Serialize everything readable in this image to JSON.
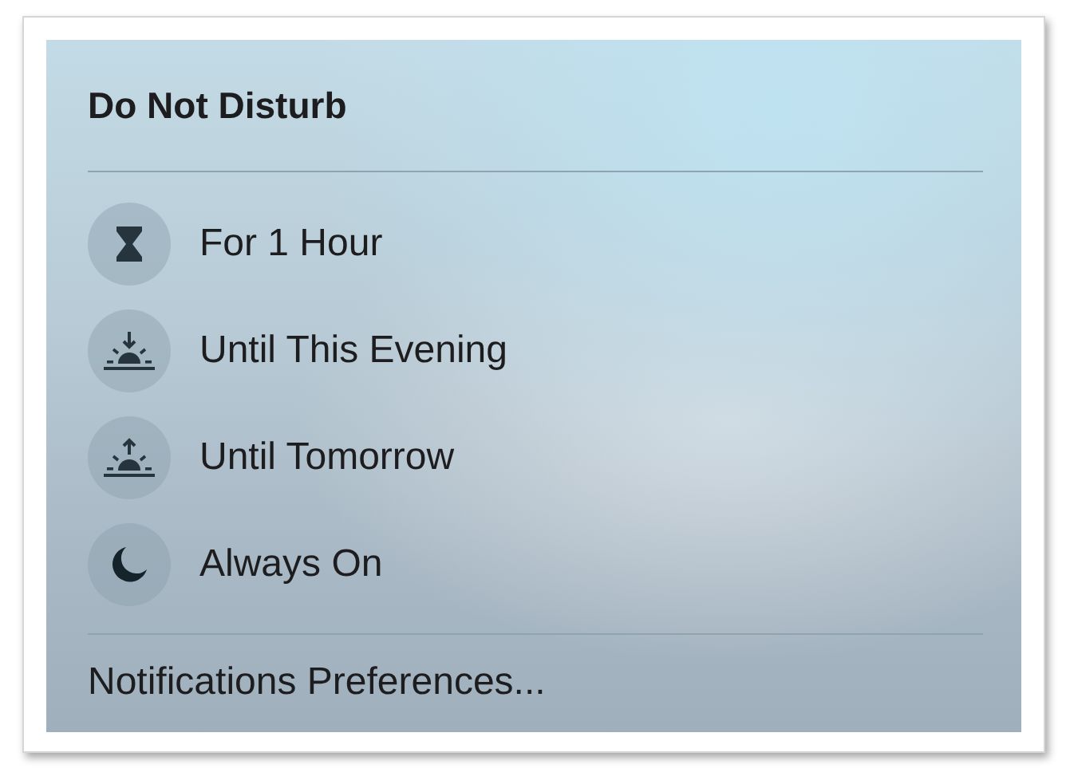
{
  "menu": {
    "title": "Do Not Disturb",
    "items": [
      {
        "label": "For 1 Hour",
        "kind": "hourglass"
      },
      {
        "label": "Until This Evening",
        "kind": "sunset"
      },
      {
        "label": "Until Tomorrow",
        "kind": "sunrise"
      },
      {
        "label": "Always On",
        "kind": "moon"
      }
    ],
    "footer": "Notifications Preferences..."
  }
}
